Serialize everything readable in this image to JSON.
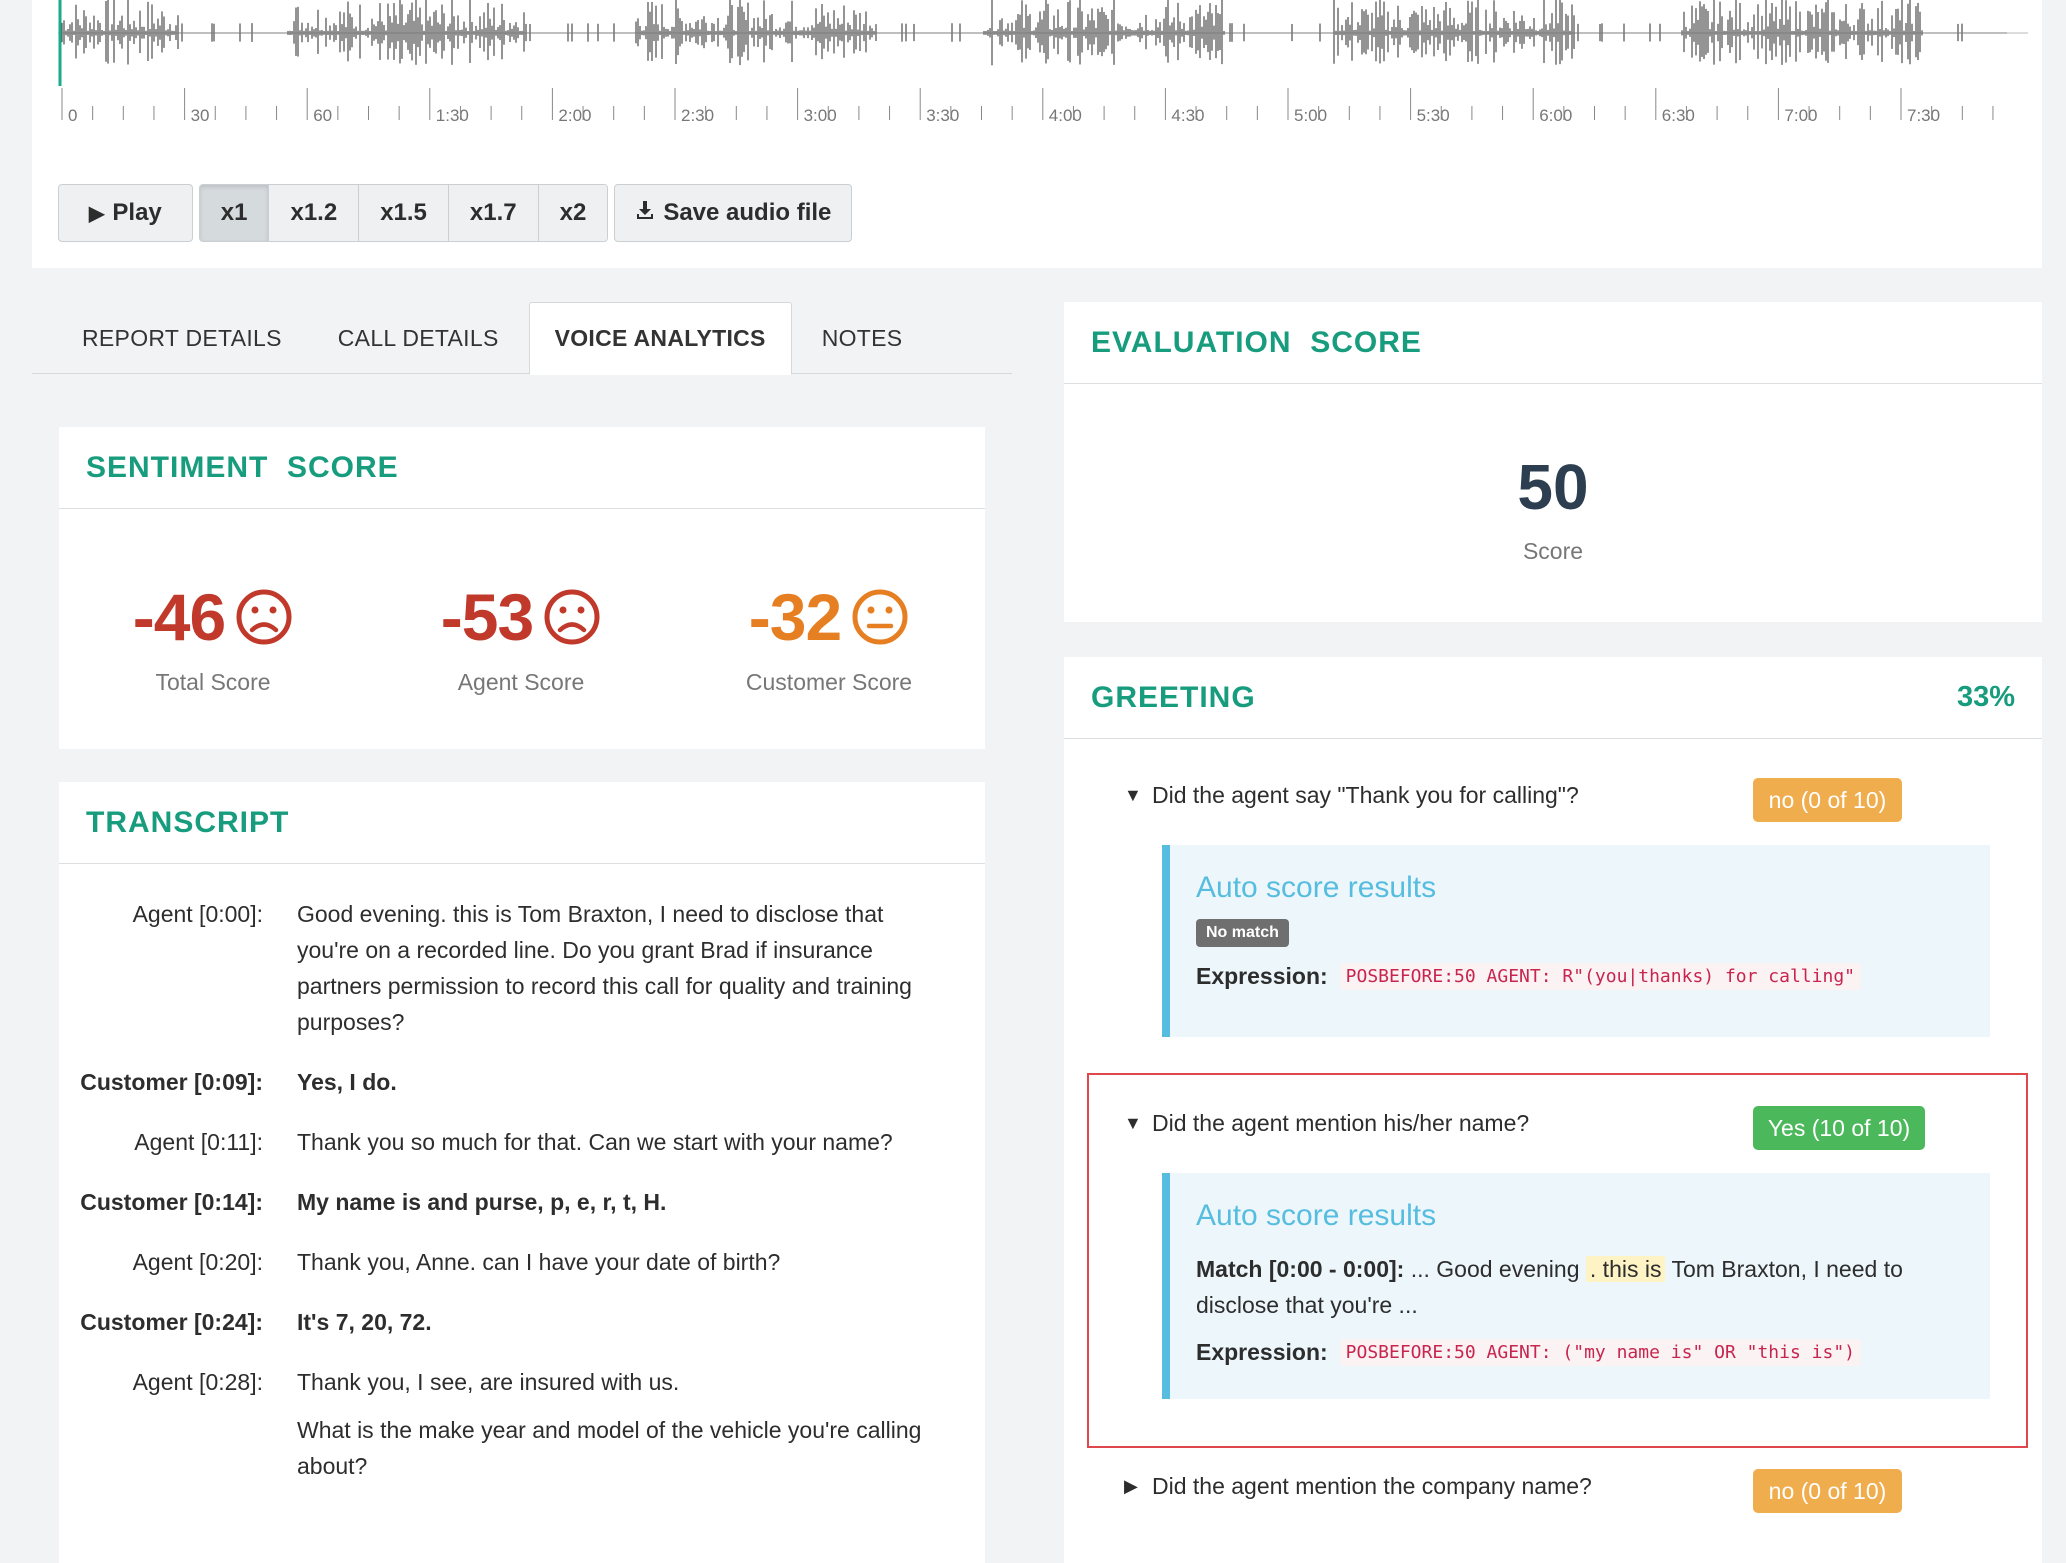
{
  "timeline": {
    "ticks": [
      "0",
      "30",
      "60",
      "1:30",
      "2:00",
      "2:30",
      "3:00",
      "3:30",
      "4:00",
      "4:30",
      "5:00",
      "5:30",
      "6:00",
      "6:30",
      "7:00",
      "7:30"
    ]
  },
  "player": {
    "play_label": "Play",
    "speeds": [
      "x1",
      "x1.2",
      "x1.5",
      "x1.7",
      "x2"
    ],
    "active_speed": "x1",
    "save_label": "Save audio file"
  },
  "tabs": {
    "report": "REPORT DETAILS",
    "call": "CALL DETAILS",
    "voice": "VOICE ANALYTICS",
    "notes": "NOTES",
    "active": "VOICE ANALYTICS"
  },
  "sentiment": {
    "title": "SENTIMENT  SCORE",
    "total": {
      "value": "-46",
      "label": "Total Score",
      "mood": "sad",
      "color": "#c0392b"
    },
    "agent": {
      "value": "-53",
      "label": "Agent Score",
      "mood": "sad",
      "color": "#c0392b"
    },
    "customer": {
      "value": "-32",
      "label": "Customer Score",
      "mood": "neutral",
      "color": "#e67e22"
    }
  },
  "transcript": {
    "title": "TRANSCRIPT",
    "lines": [
      {
        "speaker": "Agent [0:00]:",
        "text": "Good evening. this is Tom Braxton, I need to disclose that you're on a recorded line. Do you grant Brad if insurance partners permission to record this call for quality and training purposes?"
      },
      {
        "speaker": "Customer [0:09]:",
        "text": "Yes, I do."
      },
      {
        "speaker": "Agent [0:11]:",
        "text": "Thank you so much for that. Can we start with your name?"
      },
      {
        "speaker": "Customer [0:14]:",
        "text": "My name is and purse, p, e, r, t, H."
      },
      {
        "speaker": "Agent [0:20]:",
        "text": "Thank you, Anne. can I have your date of birth?"
      },
      {
        "speaker": "Customer [0:24]:",
        "text": "It's 7, 20, 72."
      },
      {
        "speaker": "Agent [0:28]:",
        "text": "Thank you, I see, are insured with us."
      },
      {
        "speaker": "",
        "text": "What is the make year and model of the vehicle you're calling about?"
      }
    ]
  },
  "evaluation": {
    "title": "EVALUATION  SCORE",
    "score": "50",
    "score_label": "Score"
  },
  "greeting": {
    "title": "GREETING",
    "percent": "33%",
    "questions": [
      {
        "text": "Did the agent say \"Thank you for calling\"?",
        "badge": "no (0 of 10)",
        "auto_title": "Auto score results",
        "status": "No match",
        "expression_label": "Expression:",
        "expression": "POSBEFORE:50 AGENT: R\"(you|thanks) for calling\""
      },
      {
        "text": "Did the agent mention his/her name?",
        "badge": "Yes (10 of 10)",
        "auto_title": "Auto score results",
        "match_label": "Match [0:00 - 0:00]:",
        "match_pre": "... Good evening",
        "match_hl": ". this is",
        "match_post": "Tom Braxton, I need to disclose that you're ...",
        "expression_label": "Expression:",
        "expression": "POSBEFORE:50 AGENT: (\"my name is\" OR \"this is\")"
      },
      {
        "text": "Did the agent mention the company name?",
        "badge": "no (0 of 10)"
      }
    ]
  },
  "colors": {
    "accent_green": "#179c7d",
    "negative": "#c0392b",
    "neutral": "#e67e22",
    "info": "#56bde0",
    "badge_no": "#f0ad4e",
    "badge_yes": "#4cb85c",
    "highlight_box": "#e0474c"
  },
  "icons": {
    "play": "play-icon",
    "save": "download-icon",
    "expanded": "caret-down-icon",
    "collapsed": "caret-right-icon"
  }
}
